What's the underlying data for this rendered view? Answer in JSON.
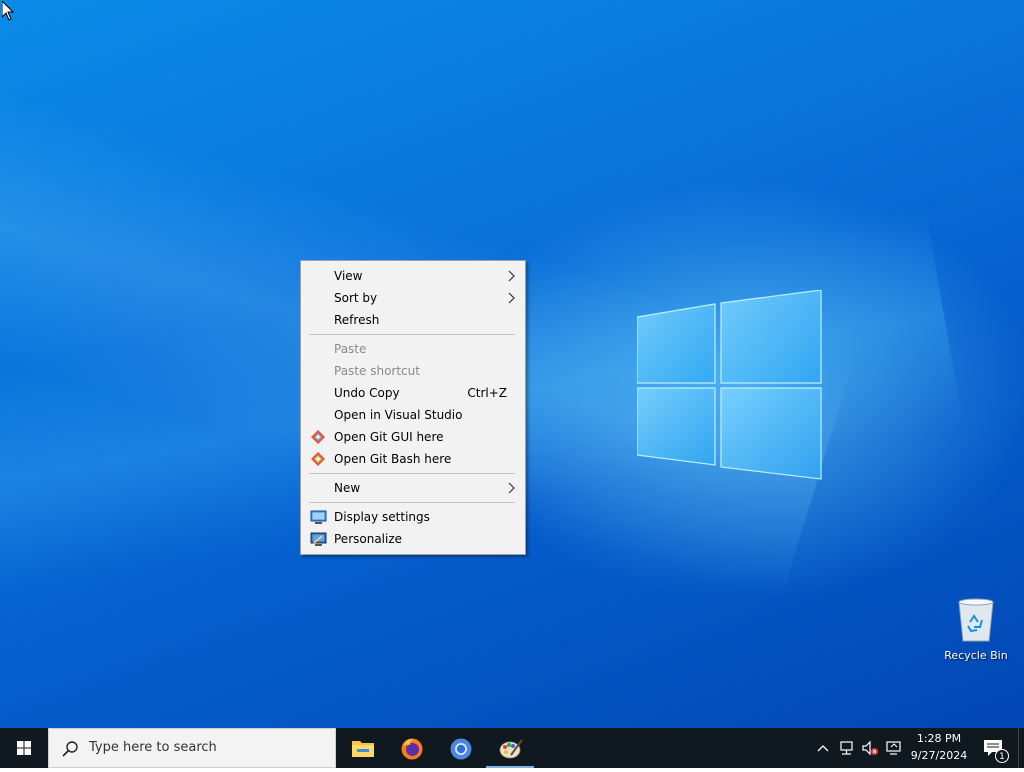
{
  "context_menu": {
    "items": [
      {
        "label": "View",
        "has_submenu": true
      },
      {
        "label": "Sort by",
        "has_submenu": true
      },
      {
        "label": "Refresh"
      },
      {
        "label": "Paste",
        "disabled": true
      },
      {
        "label": "Paste shortcut",
        "disabled": true
      },
      {
        "label": "Undo Copy",
        "shortcut": "Ctrl+Z"
      },
      {
        "label": "Open in Visual Studio"
      },
      {
        "label": "Open Git GUI here",
        "icon": "git-gui-icon"
      },
      {
        "label": "Open Git Bash here",
        "icon": "git-bash-icon"
      },
      {
        "label": "New",
        "has_submenu": true
      },
      {
        "label": "Display settings",
        "icon": "display-icon"
      },
      {
        "label": "Personalize",
        "icon": "personalize-icon"
      }
    ]
  },
  "desktop": {
    "icons": [
      {
        "label": "Recycle Bin",
        "icon": "recycle-bin-icon"
      }
    ]
  },
  "taskbar": {
    "search_placeholder": "Type here to search",
    "apps": [
      {
        "name": "File Explorer",
        "icon": "folder-icon"
      },
      {
        "name": "Firefox",
        "icon": "firefox-icon"
      },
      {
        "name": "Chromium",
        "icon": "chromium-icon"
      },
      {
        "name": "Paint",
        "icon": "paint-icon",
        "active": true
      }
    ],
    "clock": {
      "time": "1:28 PM",
      "date": "9/27/2024"
    },
    "notification_count": "1"
  },
  "colors": {
    "desktop_accent": "#0a74dc",
    "taskbar": "#101820",
    "menu_background": "#f2f2f2"
  }
}
